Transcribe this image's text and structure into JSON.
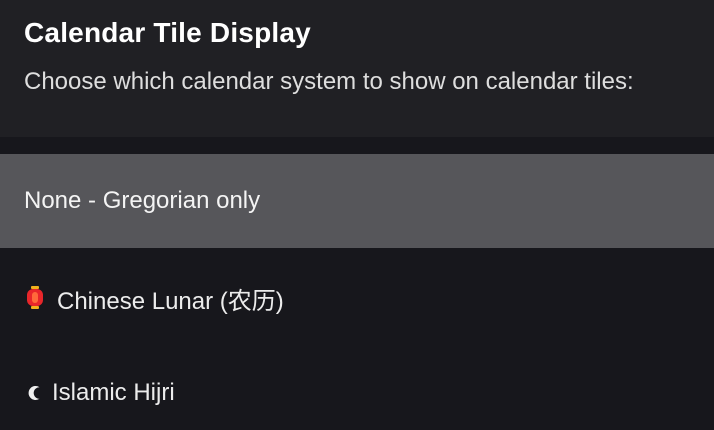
{
  "dialog": {
    "title": "Calendar Tile Display",
    "description": "Choose which calendar system to show on calendar tiles:"
  },
  "options": [
    {
      "label": "None - Gregorian only",
      "selected": true,
      "icon": ""
    },
    {
      "label": "Chinese Lunar (农历)",
      "selected": false,
      "icon": "lantern-icon"
    },
    {
      "label": "Islamic Hijri",
      "selected": false,
      "icon": "crescent-icon"
    }
  ],
  "colors": {
    "background": "#17171c",
    "header_background": "#202024",
    "selected_background": "#56565a",
    "text": "#ffffff",
    "lantern_red": "#e8262a",
    "lantern_gold": "#f2b21c"
  }
}
